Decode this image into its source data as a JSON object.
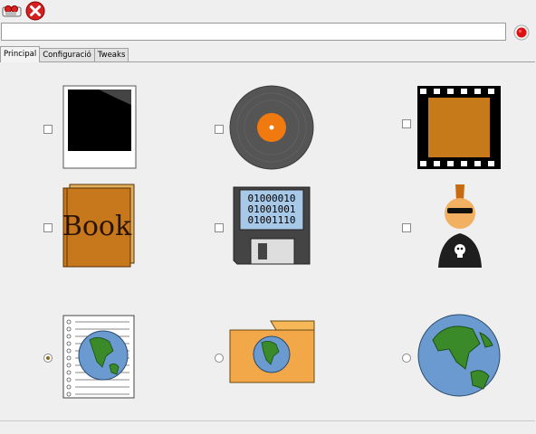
{
  "toolbar": {
    "buttons": [
      {
        "icon": "video-camera-icon"
      },
      {
        "icon": "close-icon"
      }
    ]
  },
  "url_bar": {
    "value": ""
  },
  "record_button": {
    "icon": "record-icon",
    "color": "#e01010"
  },
  "tabs": [
    {
      "label": "Principal",
      "active": true
    },
    {
      "label": "Configuració",
      "active": false
    },
    {
      "label": "Tweaks",
      "active": false
    }
  ],
  "grid": {
    "rows": [
      [
        {
          "icon": "polaroid-photo-icon",
          "control": "checkbox",
          "checked": false
        },
        {
          "icon": "vinyl-record-icon",
          "control": "checkbox",
          "checked": false
        },
        {
          "icon": "film-strip-icon",
          "control": "checkbox",
          "checked": false
        }
      ],
      [
        {
          "icon": "book-icon",
          "control": "checkbox",
          "checked": false,
          "text": "Book"
        },
        {
          "icon": "floppy-disk-icon",
          "control": "checkbox",
          "checked": false,
          "binary": [
            "01000010",
            "01001001",
            "01001110"
          ]
        },
        {
          "icon": "punk-user-icon",
          "control": "checkbox",
          "checked": false
        }
      ],
      [
        {
          "icon": "globe-document-icon",
          "control": "radio",
          "checked": true
        },
        {
          "icon": "globe-folder-icon",
          "control": "radio",
          "checked": false
        },
        {
          "icon": "globe-icon",
          "control": "radio",
          "checked": false
        }
      ]
    ]
  }
}
